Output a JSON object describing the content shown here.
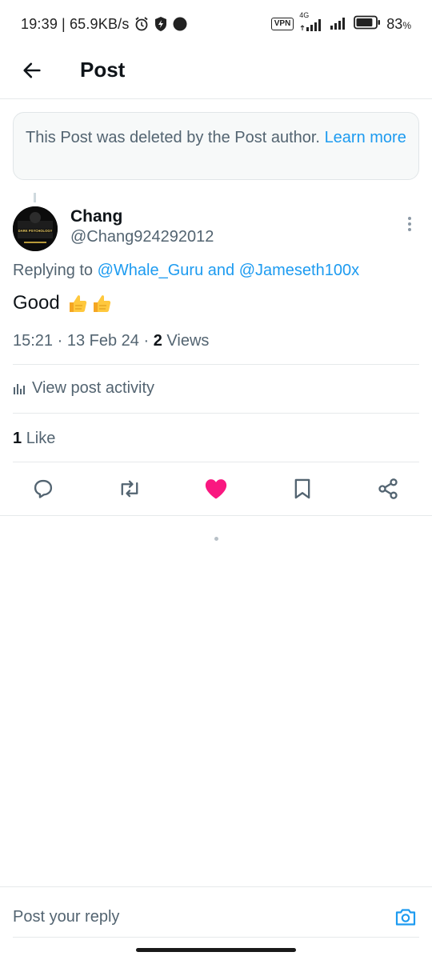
{
  "status_bar": {
    "time": "19:39",
    "separator": "|",
    "net_speed": "65.9KB/s",
    "vpn_label": "VPN",
    "network_type": "4G",
    "battery_percent": "83",
    "battery_level": 0.83,
    "icons": [
      "alarm-icon",
      "shield-bolt-icon",
      "dot-icon",
      "vpn-icon",
      "signal-icon",
      "battery-icon"
    ]
  },
  "header": {
    "title": "Post",
    "back_icon": "arrow-left-icon"
  },
  "notice": {
    "text": "This Post was deleted by the Post author.",
    "link_text": "Learn more"
  },
  "tweet": {
    "author_name": "Chang",
    "author_handle": "@Chang924292012",
    "replying_prefix": "Replying to",
    "mention_1": "@Whale_Guru",
    "mention_joiner": "and",
    "mention_2": "@Jameseth100x",
    "text": "Good",
    "emoji": "👍👍",
    "time": "15:21",
    "meta_sep": "·",
    "date": "13 Feb 24",
    "views_count": "2",
    "views_label": "Views",
    "activity_label": "View post activity",
    "likes_count": "1",
    "likes_label": "Like",
    "avatar_text": "DARK PSYCHOLOGY"
  },
  "actions": {
    "icons": [
      "reply-icon",
      "retweet-icon",
      "like-icon",
      "bookmark-icon",
      "share-icon"
    ],
    "liked": true,
    "like_color": "#f91880",
    "icon_color": "#536471"
  },
  "reply_bar": {
    "placeholder": "Post your reply",
    "camera_icon": "camera-icon",
    "accent": "#1d9bf0"
  }
}
